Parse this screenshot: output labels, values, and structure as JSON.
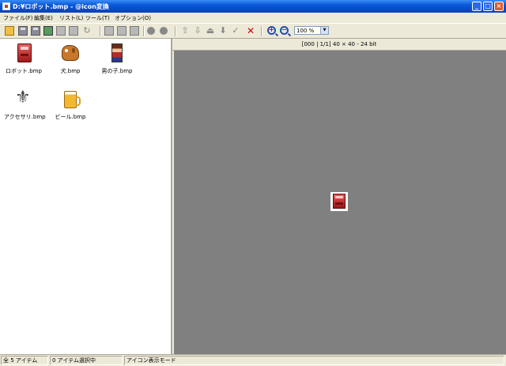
{
  "window": {
    "title": "D:¥ロボット.bmp - @icon変換"
  },
  "menu": [
    "ファイル(F)",
    "編集(E)",
    "リスト(L)",
    "ツール(T)",
    "オプション(O)"
  ],
  "toolbar": {
    "zoom_value": "100 %",
    "icons": [
      "open-folder-icon",
      "save-icon",
      "save-as-icon",
      "import-icon",
      "export-icon",
      "convert-icon",
      "rotate-icon",
      "copy-icon",
      "paste-icon",
      "paste-new-icon",
      "person-icon",
      "person2-icon",
      "up-arrow-icon",
      "down-arrow-icon",
      "bring-icon",
      "send-icon",
      "check-icon",
      "delete-icon",
      "zoom-in-icon",
      "zoom-out-icon"
    ]
  },
  "files": [
    {
      "name": "ロボット.bmp",
      "icon": "robot-icon"
    },
    {
      "name": "犬.bmp",
      "icon": "dog-icon"
    },
    {
      "name": "男の子.bmp",
      "icon": "boy-icon"
    },
    {
      "name": "アクセサリ.bmp",
      "icon": "accessory-icon"
    },
    {
      "name": "ビール.bmp",
      "icon": "beer-icon"
    }
  ],
  "preview": {
    "info": "[000 | 1/1] 40 × 40 - 24 bit"
  },
  "status": {
    "items": "全 5 アイテム",
    "selected": "0 アイテム選択中",
    "mode": "アイコン表示モード"
  },
  "colors": {
    "titlebar": "#0a58d9",
    "canvas": "#808080",
    "chrome": "#ece9d8"
  }
}
